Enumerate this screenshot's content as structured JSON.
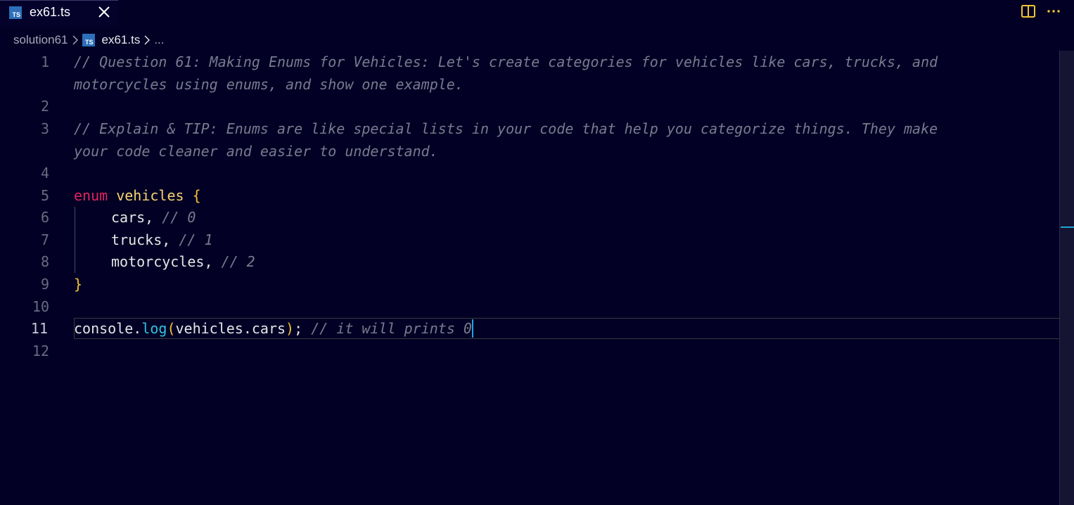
{
  "tabs": [
    {
      "label": "ex61.ts",
      "icon": "ts-file-icon",
      "active": true
    }
  ],
  "breadcrumb": {
    "folder": "solution61",
    "file": "ex61.ts",
    "more": "..."
  },
  "editor": {
    "line_numbers": [
      "1",
      "2",
      "3",
      "4",
      "5",
      "6",
      "7",
      "8",
      "9",
      "10",
      "11",
      "12"
    ],
    "active_line": "11",
    "lines": {
      "l1a": "// Question 61: Making Enums for Vehicles: Let's create categories for vehicles like cars, trucks, and",
      "l1b": "motorcycles using enums, and show one example.",
      "l3a": "// Explain & TIP: Enums are like special lists in your code that help you categorize things. They make",
      "l3b": "your code cleaner and easier to understand.",
      "l5_kw": "enum",
      "l5_name": "vehicles",
      "l5_brace": "{",
      "l6_code": "cars,",
      "l6_comment": "// 0",
      "l7_code": "trucks,",
      "l7_comment": "// 1",
      "l8_code": "motorcycles,",
      "l8_comment": "// 2",
      "l9_brace": "}",
      "l11_obj": "console.",
      "l11_fn": "log",
      "l11_open": "(",
      "l11_arg": "vehicles.cars",
      "l11_close": ")",
      "l11_semi": ";",
      "l11_comment": "// it will prints 0"
    }
  },
  "colors": {
    "background": "#020125",
    "keyword": "#e0245e",
    "type": "#f8d270",
    "function": "#2fc3e0",
    "comment": "#7a7a8e",
    "ts_icon": "#2d6fb9"
  }
}
